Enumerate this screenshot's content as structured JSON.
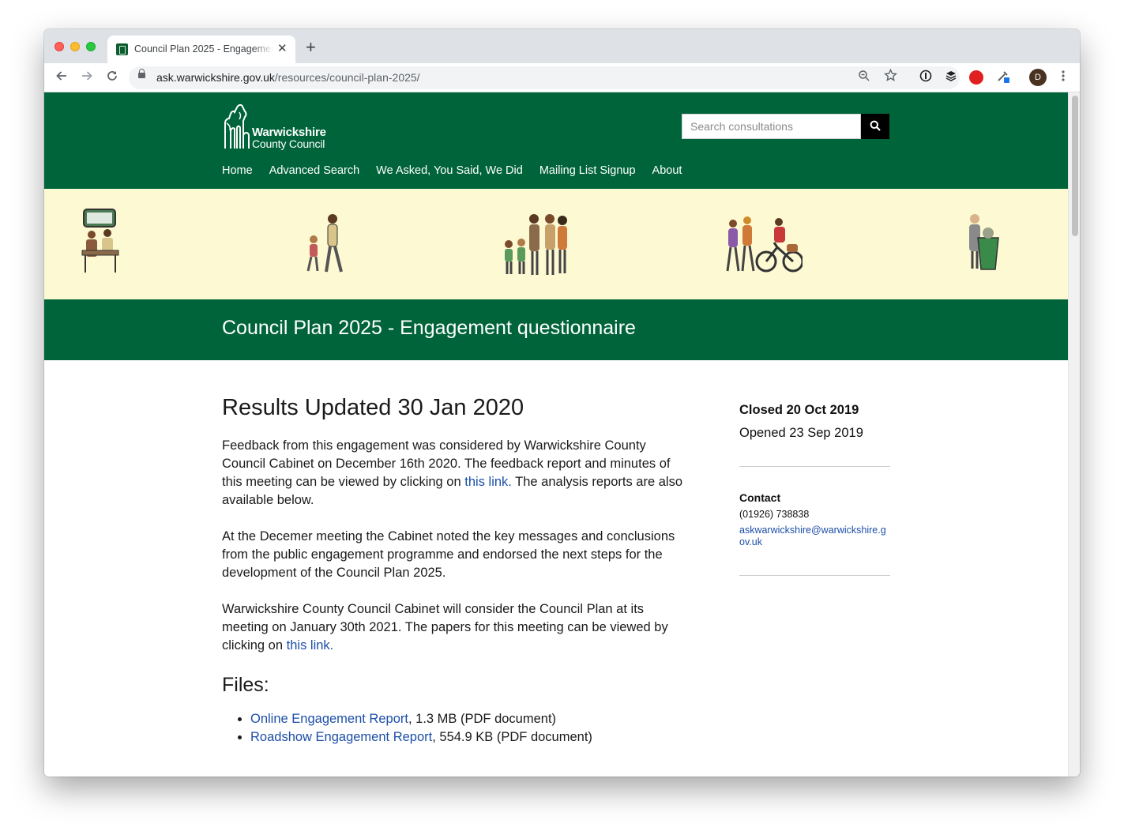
{
  "browser": {
    "tab_title": "Council Plan 2025 - Engagement questionnaire",
    "tab_close": "✕",
    "new_tab": "+",
    "url_host": "ask.warwickshire.gov.uk",
    "url_path": "/resources/council-plan-2025/",
    "profile_initial": "D",
    "icons": [
      "back-arrow-icon",
      "forward-arrow-icon",
      "reload-icon",
      "lock-icon",
      "zoom-icon",
      "star-icon",
      "info-icon",
      "layers-icon",
      "adblock-icon",
      "dropper-icon",
      "kebab-menu-icon"
    ]
  },
  "site": {
    "logo_line1": "Warwickshire",
    "logo_line2": "County Council",
    "search_placeholder": "Search consultations",
    "nav": [
      "Home",
      "Advanced Search",
      "We Asked, You Said, We Did",
      "Mailing List Signup",
      "About"
    ],
    "brand_color": "#00643a",
    "banner_color": "#fdf9d2",
    "link_color": "#1d4fa8"
  },
  "page": {
    "title": "Council Plan 2025 - Engagement questionnaire",
    "results_heading": "Results Updated 30 Jan 2020",
    "para1_text": "Feedback from this engagement was considered by Warwickshire County Council Cabinet on December 16th 2020. The feedback report and minutes of this meeting can be viewed by clicking on",
    "para1_link": "this link.",
    "para1_tail": " The analysis reports are also available below.",
    "para2": "At the Decemer meeting the Cabinet noted the key messages and conclusions from the public engagement programme and endorsed the next steps for the development of the Council Plan 2025.",
    "para3_text": "Warwickshire County Council Cabinet will consider the Council Plan at its meeting on January 30th 2021. The papers for this meeting can be viewed by clicking on",
    "para3_link": "this link.",
    "files_heading": "Files:",
    "files": [
      {
        "name": "Online Engagement Report",
        "meta": ", 1.3 MB (PDF document)"
      },
      {
        "name": "Roadshow Engagement Report",
        "meta": ", 554.9 KB (PDF document)"
      }
    ]
  },
  "sidebar": {
    "closed": "Closed 20 Oct 2019",
    "opened": "Opened 23 Sep 2019",
    "contact_heading": "Contact",
    "phone": "(01926) 738838",
    "email": "askwarwickshire@warwickshire.gov.uk"
  }
}
